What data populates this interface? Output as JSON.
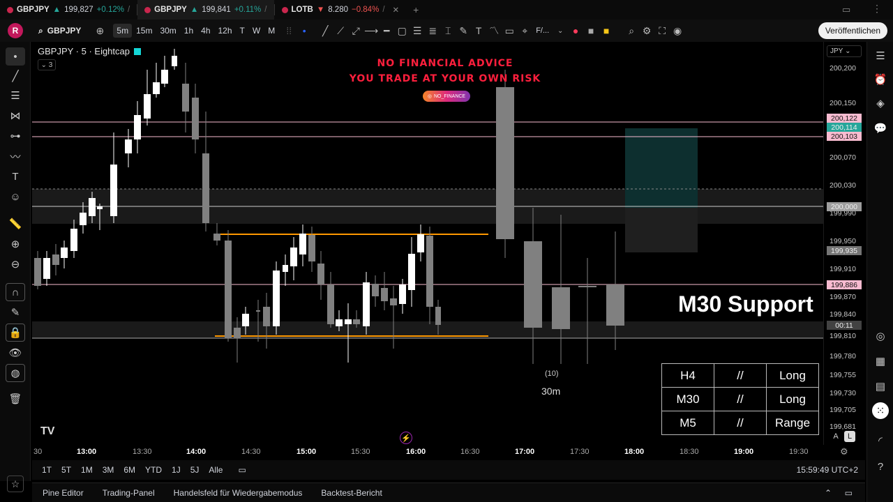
{
  "tabs": [
    {
      "symbol": "GBPJPY",
      "arrow": "▲",
      "price": "199,827",
      "change": "+0.12%",
      "extra": "/"
    },
    {
      "symbol": "GBPJPY",
      "arrow": "▲",
      "price": "199,841",
      "change": "+0.11%",
      "extra": "/"
    },
    {
      "symbol": "LOTB",
      "arrow": "▼",
      "price": "8.280",
      "change": "−0.84%",
      "extra": "/"
    }
  ],
  "toolbar": {
    "avatar_letter": "R",
    "symbol": "GBPJPY",
    "timeframes": [
      "5m",
      "15m",
      "30m",
      "1h",
      "4h",
      "12h",
      "T",
      "W",
      "M"
    ],
    "active_timeframe": "5m",
    "fx_label": "F/...",
    "publish_label": "Veröffentlichen"
  },
  "legend": {
    "title": "GBPJPY · 5 · Eightcap",
    "collapse_count": "3"
  },
  "overlay": {
    "warning_line1": "NO FINANCIAL ADVICE",
    "warning_line2": "YOU TRADE AT YOUR OWN RISK",
    "instagram_handle": "NO_FINANCE",
    "support_label": "M30 Support",
    "count_label": "(10)",
    "timeframe_label": "30m"
  },
  "trend_table": [
    [
      "H4",
      "//",
      "Long"
    ],
    [
      "M30",
      "//",
      "Long"
    ],
    [
      "M5",
      "//",
      "Range"
    ]
  ],
  "price_axis": {
    "currency": "JPY",
    "labels": [
      "200,200",
      "200,150",
      "200,070",
      "200,030",
      "199,990",
      "199,950",
      "199,910",
      "199,870",
      "199,840",
      "199,810",
      "199,780",
      "199,755",
      "199,730",
      "199,705",
      "199,681"
    ],
    "badges": [
      {
        "text": "200,122",
        "color": "#f8bbd0"
      },
      {
        "text": "200,114",
        "color": "#26a69a"
      },
      {
        "text": "200,103",
        "color": "#f8bbd0"
      },
      {
        "text": "200,000",
        "color": "#9e9e9e"
      },
      {
        "text": "199,935",
        "color": "#757575"
      },
      {
        "text": "199,886",
        "color": "#f8bbd0"
      },
      {
        "text": "00:11",
        "color": "#424242"
      }
    ]
  },
  "time_axis": {
    "labels": [
      "30",
      "13:00",
      "13:30",
      "14:00",
      "14:30",
      "15:00",
      "15:30",
      "16:00",
      "16:30",
      "17:00",
      "17:30",
      "18:00",
      "18:30",
      "19:00",
      "19:30"
    ],
    "bold": [
      "13:00",
      "14:00",
      "15:00",
      "16:00",
      "17:00",
      "18:00",
      "19:00"
    ]
  },
  "range_bar": {
    "ranges": [
      "1T",
      "5T",
      "1M",
      "3M",
      "6M",
      "YTD",
      "1J",
      "5J",
      "Alle"
    ],
    "clock": "15:59:49 UTC+2"
  },
  "bottom_tabs": [
    "Pine Editor",
    "Trading-Panel",
    "Handelsfeld für Wiedergabemodus",
    "Backtest-Bericht"
  ],
  "scale_buttons": [
    "A",
    "L"
  ],
  "colors": {
    "bull": "#ffffff",
    "bear": "#808080",
    "range_line": "#ff9800",
    "pink_line": "#f8bbd0",
    "accent": "#c9264d"
  }
}
